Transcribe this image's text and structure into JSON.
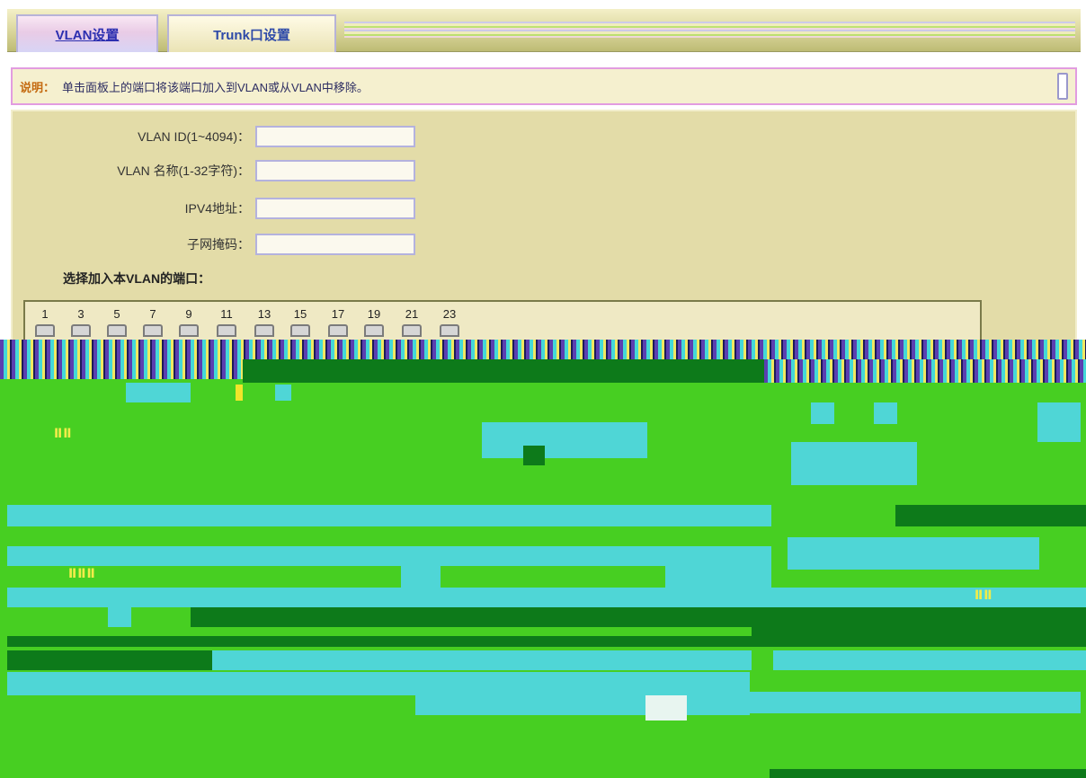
{
  "tabs": [
    {
      "label": "VLAN设置"
    },
    {
      "label": "Trunk口设置"
    }
  ],
  "note": {
    "tag": "说明：",
    "text": "单击面板上的端口将该端口加入到VLAN或从VLAN中移除。"
  },
  "form": {
    "vlan_id_label": "VLAN ID(1~4094)：",
    "vlan_id_value": "",
    "vlan_name_label": "VLAN 名称(1-32字符)：",
    "vlan_name_value": "",
    "ipv4_label": "IPV4地址：",
    "ipv4_value": "",
    "mask_label": "子网掩码：",
    "mask_value": "",
    "ports_title": "选择加入本VLAN的端口："
  },
  "ports": [
    "1",
    "3",
    "5",
    "7",
    "9",
    "11",
    "13",
    "15",
    "17",
    "19",
    "21",
    "23"
  ],
  "colors": {
    "tab_text": "#2c2fb0",
    "note_border": "#e29ce0",
    "panel_bg": "#e3dca8",
    "noise_green": "#47cf22",
    "noise_cyan": "#4fd6d6"
  }
}
